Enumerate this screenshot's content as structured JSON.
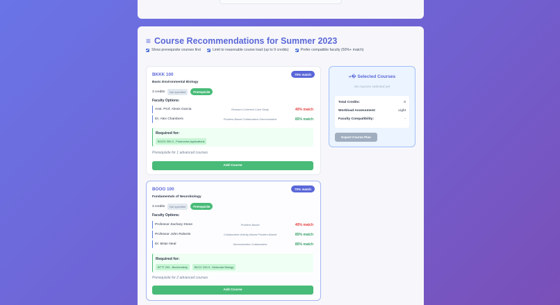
{
  "page": {
    "heading_icon": "≡",
    "heading": "Course Recommendations for Summer 2023",
    "options": [
      {
        "label": "Show prerequisite courses first",
        "checked": true
      },
      {
        "label": "Limit to reasonable course load (up to 9 credits)",
        "checked": true
      },
      {
        "label": "Prefer compatible faculty (50%+ match)",
        "checked": true
      }
    ]
  },
  "courses": [
    {
      "code": "BKKK 100",
      "match": "70% match",
      "title": "Basic Environmental Biology",
      "credits": "3 credits",
      "status": "Not specified",
      "badge": "Prerequisite",
      "faculty_label": "Faculty Options:",
      "faculty": [
        {
          "name": "Asst. Prof. Alexis Garcia",
          "style": "Research-Oriented Case Study",
          "match": "40% match"
        },
        {
          "name": "Dr. Alex Chambers",
          "style": "Problem-Based Collaborative Demonstrative",
          "match": "85% match"
        }
      ],
      "required_label": "Required for:",
      "required_for": [
        "BOOO 300-3 - Proteomics Applications"
      ],
      "prereq_note": "Prerequisite for 1 advanced courses",
      "add_label": "Add Course"
    },
    {
      "code": "BOOO 100",
      "match": "70% match",
      "title": "Fundamentals of Neurobiology",
      "credits": "3 credits",
      "status": "Not specified",
      "badge": "Prerequisite",
      "faculty_label": "Faculty Options:",
      "faculty": [
        {
          "name": "Professor Zachary Stone",
          "style": "Problem-Based",
          "match": "40% match"
        },
        {
          "name": "Professor John Roberts",
          "style": "Collaborative Activity-Based Problem-Based",
          "match": "85% match"
        },
        {
          "name": "Dr. Brian Neal",
          "style": "Demonstrative Collaborative",
          "match": "85% match"
        }
      ],
      "required_label": "Required for:",
      "required_for": [
        "BTTT 200 - Biochemistry",
        "BCCC 200-9 - Molecular Biology"
      ],
      "prereq_note": "Prerequisite for 2 advanced courses",
      "add_label": "Add Course"
    }
  ],
  "selected": {
    "title": "»� Selected Courses",
    "empty": "No courses selected yet",
    "total_credits_label": "Total Credits:",
    "total_credits": "0",
    "workload_label": "Workload Assessment:",
    "workload": "Light",
    "compat_label": "Faculty Compatibility:",
    "compat": "-",
    "export_label": "Export Course Plan"
  },
  "colors": {
    "accent": "#5a67d8",
    "success": "#48bb78",
    "danger": "#e53e3e"
  }
}
